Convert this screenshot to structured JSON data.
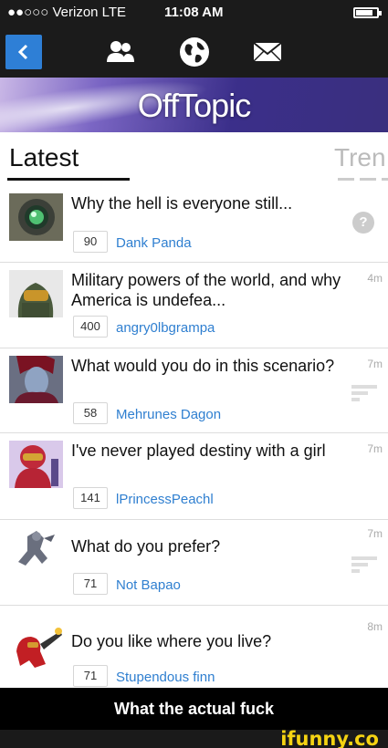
{
  "status_bar": {
    "carrier": "●●○○○ Verizon  LTE",
    "time": "11:08 AM"
  },
  "nav": {
    "icons": [
      "back-icon",
      "friends-icon",
      "globe-icon",
      "mail-icon"
    ],
    "accent": "#2e7fd6"
  },
  "banner": {
    "title": "OffTopic"
  },
  "tabs": {
    "latest": "Latest",
    "trending": "Tren"
  },
  "feed": {
    "rows": [
      {
        "title": "Why the hell is everyone still...",
        "count": "90",
        "author": "Dank Panda",
        "age": "",
        "status_icon": "help-icon"
      },
      {
        "title": "Military powers of the world, and why America is undefea...",
        "count": "400",
        "author": "angry0lbgrampa",
        "age": "4m",
        "status_icon": ""
      },
      {
        "title": "What would you do in this scenario?",
        "count": "58",
        "author": "Mehrunes Dagon",
        "age": "7m",
        "status_icon": "bars-icon"
      },
      {
        "title": "I've never played destiny with a girl",
        "count": "141",
        "author": "lPrincessPeachl",
        "age": "7m",
        "status_icon": ""
      },
      {
        "title": "What do you prefer?",
        "count": "71",
        "author": "Not Bapao",
        "age": "7m",
        "status_icon": "bars-icon"
      },
      {
        "title": "Do you like where you live?",
        "count": "71",
        "author": "Stupendous finn",
        "age": "8m",
        "status_icon": ""
      }
    ]
  },
  "caption": "What the actual fuck",
  "watermark": "ifunny.co"
}
